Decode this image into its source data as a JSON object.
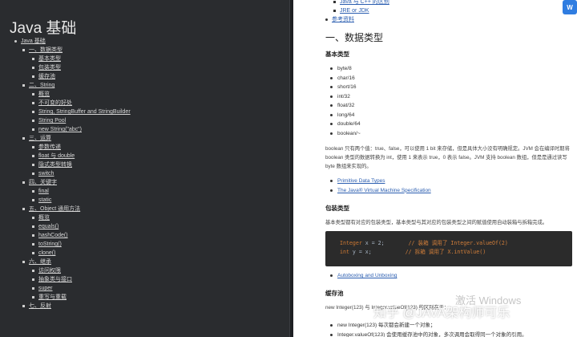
{
  "left": {
    "title": "Java 基础",
    "root": "Java 基础",
    "sections": [
      {
        "label": "一、数据类型",
        "items": [
          "基本类型",
          "包装类型",
          "缓存池"
        ]
      },
      {
        "label": "二、String",
        "items": [
          "概览",
          "不可变的好处",
          "String, StringBuffer and StringBuilder",
          "String Pool",
          "new String(\"abc\")"
        ]
      },
      {
        "label": "三、运算",
        "items": [
          "参数传递",
          "float 与 double",
          "隐式类型转换",
          "switch"
        ]
      },
      {
        "label": "四、关键字",
        "items": [
          "final",
          "static"
        ]
      },
      {
        "label": "五、Object 通用方法",
        "items": [
          "概览",
          "equals()",
          "hashCode()",
          "toString()",
          "clone()"
        ]
      },
      {
        "label": "六、继承",
        "items": [
          "访问权限",
          "抽象类与接口",
          "super",
          "重写与重载"
        ]
      },
      {
        "label": "七、反射",
        "items": []
      }
    ]
  },
  "right": {
    "topnav": [
      "Java 与 C++ 的区别",
      "JRE or JDK",
      "参考资料"
    ],
    "h1": "一、数据类型",
    "h3_basic": "基本类型",
    "basic_types": [
      "byte/8",
      "char/16",
      "short/16",
      "int/32",
      "float/32",
      "long/64",
      "double/64",
      "boolean/~"
    ],
    "boolean_para": "boolean 只有两个值：true、false，可以使用 1 bit 来存储，但是具体大小没有明确规定。JVM 会在编译时期将 boolean 类型的数据转换为 int，使用 1 来表示 true，0 表示 false。JVM 支持 boolean 数组，但是是通过读写 byte 数组来实现的。",
    "refs": [
      "Primitive Data Types",
      "The Java® Virtual Machine Specification"
    ],
    "h3_wrapper": "包装类型",
    "wrapper_para": "基本类型都有对应的包装类型，基本类型与其对应的包装类型之间的赋值使用自动装箱与拆箱完成。",
    "code": {
      "line1_kw": "Integer",
      "line1_txt": " x = 2;",
      "line1_cm": "// 装箱 调用了 Integer.valueOf(2)",
      "line2_kw": "int",
      "line2_txt": " y = x;",
      "line2_cm": "// 拆箱 调用了 X.intValue()"
    },
    "autoboxing": "Autoboxing and Unboxing",
    "h3_cache": "缓存池",
    "cache_para": "new Integer(123) 与 Integer.valueOf(123) 的区别在于：",
    "cache_items": [
      "new Integer(123) 每次都会新建一个对象；",
      "Integer.valueOf(123) 会使用缓存池中的对象，多次调用会取得同一个对象的引用。"
    ],
    "badge": "W",
    "watermark_windows": "激活 Windows",
    "watermark_zhihu": "知乎 @JAVA架构师可乐"
  }
}
